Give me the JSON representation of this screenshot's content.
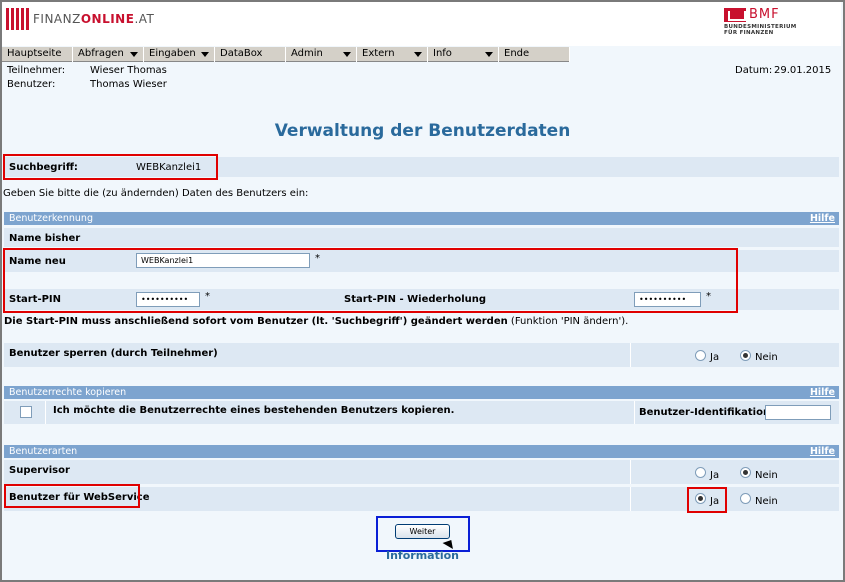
{
  "header": {
    "logo_prefix": "FINANZ",
    "logo_main": "ONLINE",
    "logo_suffix": ".AT",
    "bmf_label": "BMF",
    "bmf_sub1": "BUNDESMINISTERIUM",
    "bmf_sub2": "FÜR FINANZEN"
  },
  "menu": [
    {
      "label": "Hauptseite"
    },
    {
      "label": "Abfragen"
    },
    {
      "label": "Eingaben"
    },
    {
      "label": "DataBox"
    },
    {
      "label": "Admin"
    },
    {
      "label": "Extern"
    },
    {
      "label": "Info"
    },
    {
      "label": "Ende"
    }
  ],
  "session": {
    "teilnehmer_label": "Teilnehmer:",
    "teilnehmer_value": "Wieser Thomas",
    "benutzer_label": "Benutzer:",
    "benutzer_value": "Thomas Wieser",
    "datum_label": "Datum:",
    "datum_value": "29.01.2015"
  },
  "page_title": "Verwaltung der Benutzerdaten",
  "search": {
    "label": "Suchbegriff:",
    "value": "WEBKanzlei1"
  },
  "intro_text": "Geben Sie bitte die (zu ändernden) Daten des Benutzers ein:",
  "section_kennung": {
    "title": "Benutzerkennung",
    "hilfe": "Hilfe",
    "name_bisher_label": "Name bisher",
    "name_neu_label": "Name neu",
    "name_neu_value": "WEBKanzlei1",
    "required_mark": "*",
    "start_pin_label": "Start-PIN",
    "start_pin_value": "••••••••••",
    "start_pin_repeat_label": "Start-PIN - Wiederholung",
    "start_pin_repeat_value": "••••••••••",
    "pin_note_bold": "Die Start-PIN muss anschließend sofort vom Benutzer (lt. 'Suchbegriff') geändert werden",
    "pin_note_normal": "(Funktion 'PIN ändern').",
    "sperren_label": "Benutzer sperren (durch Teilnehmer)",
    "sperren_ja": "Ja",
    "sperren_nein": "Nein"
  },
  "section_rechte": {
    "title": "Benutzerrechte kopieren",
    "hilfe": "Hilfe",
    "copy_label": "Ich möchte die Benutzerrechte eines bestehenden Benutzers kopieren.",
    "ident_label": "Benutzer-Identifikation",
    "ident_value": ""
  },
  "section_arten": {
    "title": "Benutzerarten",
    "hilfe": "Hilfe",
    "supervisor_label": "Supervisor",
    "supervisor_ja": "Ja",
    "supervisor_nein": "Nein",
    "webservice_label": "Benutzer für WebService",
    "webservice_ja": "Ja",
    "webservice_nein": "Nein"
  },
  "button_weiter": "Weiter",
  "information_label": "Information",
  "colors": {
    "accent_blue": "#2a6a9c",
    "section_header": "#7da4cf",
    "highlight_red": "#e00000",
    "highlight_blue": "#0a1fd6",
    "brand_red": "#c8102e"
  }
}
